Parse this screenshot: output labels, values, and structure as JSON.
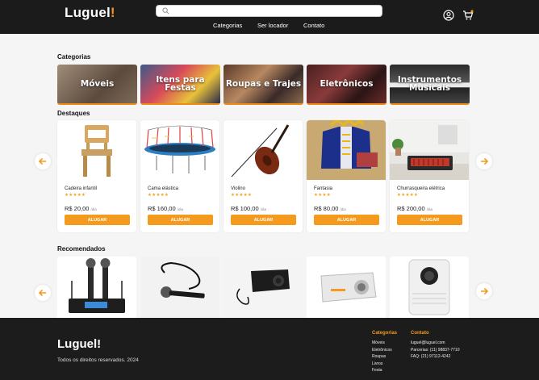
{
  "header": {
    "logo": "Luguel",
    "logo_mark": "!",
    "search_placeholder": "",
    "nav": [
      "Categorias",
      "Ser locador",
      "Contato"
    ]
  },
  "categories_title": "Categorias",
  "categories": [
    {
      "label": "Móveis"
    },
    {
      "label": "Itens para Festas"
    },
    {
      "label": "Roupas e Trajes"
    },
    {
      "label": "Eletrônicos"
    },
    {
      "label": "Instrumentos Musicais"
    }
  ],
  "highlights_title": "Destaques",
  "products": [
    {
      "name": "Cadeira infantil",
      "stars": "★★★★★",
      "price": "R$ 20,00",
      "per": "/dia",
      "button": "ALUGAR"
    },
    {
      "name": "Cama elástica",
      "stars": "★★★★★",
      "price": "R$ 160,00",
      "per": "/dia",
      "button": "ALUGAR"
    },
    {
      "name": "Violino",
      "stars": "★★★★★",
      "price": "R$ 100,00",
      "per": "/dia",
      "button": "ALUGAR"
    },
    {
      "name": "Fantasia",
      "stars": "★★★★",
      "price": "R$ 80,00",
      "per": "/dia",
      "button": "ALUGAR"
    },
    {
      "name": "Churrasqueira elétrica",
      "stars": "★★★★★",
      "price": "R$ 200,00",
      "per": "/dia",
      "button": "ALUGAR"
    }
  ],
  "recommended_title": "Recomendados",
  "footer": {
    "logo": "Luguel!",
    "rights": "Todos os direitos reservados. 2024",
    "categories_heading": "Categorias",
    "categories": [
      "Móveis",
      "Eletrônicos",
      "Roupas",
      "Livros",
      "Festa"
    ],
    "contact_heading": "Contato",
    "contact": [
      "luguel@luguel.com",
      "Parcerias: (11) 98837-7710",
      "FAQ: (21) 97112-4242"
    ]
  },
  "colors": {
    "accent": "#f39a1f",
    "header_bg": "#1b1b1b",
    "footer_bg": "#1c1c1c"
  }
}
